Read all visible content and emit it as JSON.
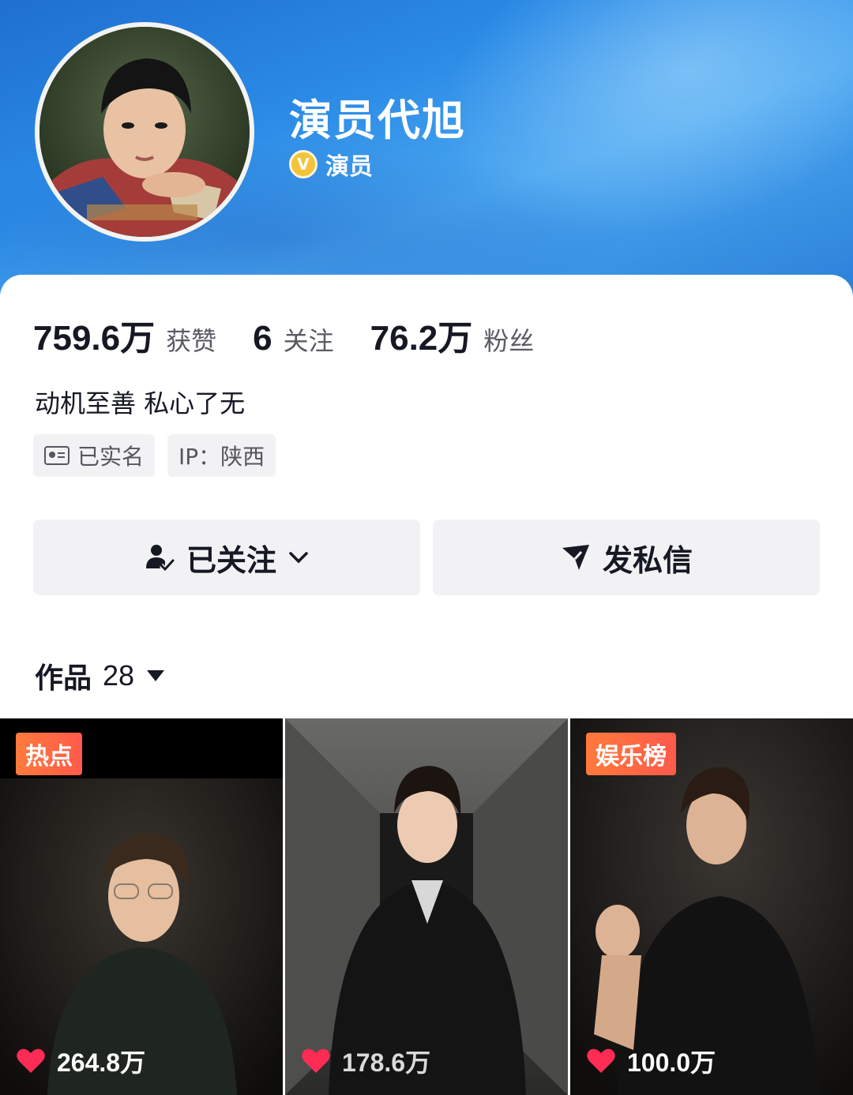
{
  "profile": {
    "name": "演员代旭",
    "verify_label": "演员",
    "verify_badge": "V",
    "bio": "动机至善 私心了无"
  },
  "stats": [
    {
      "value": "759.6万",
      "label": "获赞"
    },
    {
      "value": "6",
      "label": "关注"
    },
    {
      "value": "76.2万",
      "label": "粉丝"
    }
  ],
  "tags": {
    "real_name": "已实名",
    "ip": "IP：陕西"
  },
  "actions": {
    "follow_label": "已关注",
    "message_label": "发私信"
  },
  "works": {
    "label": "作品",
    "count": "28"
  },
  "videos": [
    {
      "badge": "热点",
      "likes": "264.8万"
    },
    {
      "badge": "",
      "likes": "178.6万"
    },
    {
      "badge": "娱乐榜",
      "likes": "100.0万"
    }
  ],
  "colors": {
    "banner": "#2b8be6",
    "badge": "#ff6a44",
    "heart": "#fe2c55",
    "verify": "#f4c33b"
  },
  "icons": [
    "id-card-icon",
    "user-check-icon",
    "chevron-down-icon",
    "send-icon",
    "caret-down-icon",
    "heart-icon"
  ]
}
